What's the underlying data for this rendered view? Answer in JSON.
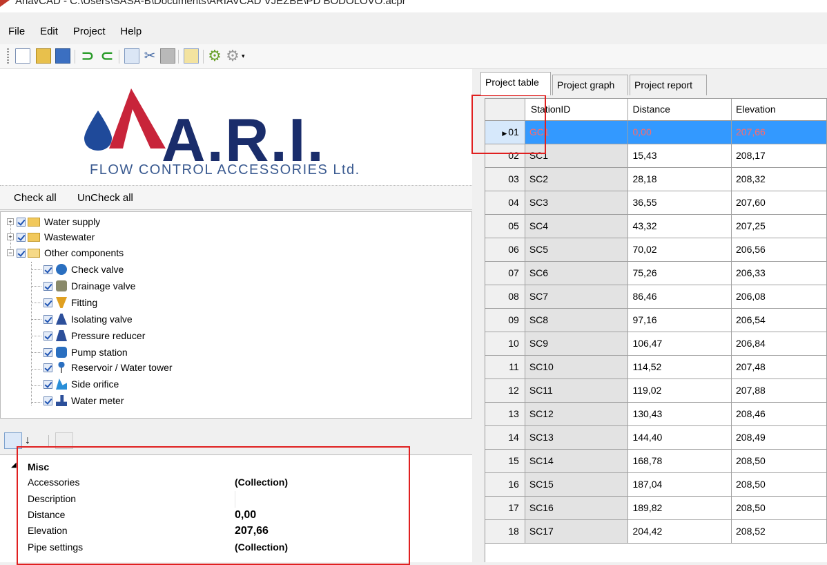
{
  "window": {
    "title": "AriavCAD - C:\\Users\\SASA-B\\Documents\\ARIAVCAD VJEZBE\\PD BODOLOVO.acpr"
  },
  "menu": [
    "File",
    "Edit",
    "Project",
    "Help"
  ],
  "toolbar": [
    "new-icon",
    "open-icon",
    "save-icon",
    "undo-icon",
    "redo-icon",
    "copy-icon",
    "cut-icon",
    "paste-icon",
    "properties-icon",
    "settings-icon",
    "settings-dropdown-icon"
  ],
  "logo": {
    "text": "A.R.I.",
    "subtitle": "FLOW CONTROL ACCESSORIES Ltd."
  },
  "checkbar": {
    "check_all": "Check all",
    "uncheck_all": "UnCheck all"
  },
  "tree": [
    {
      "label": "Water supply",
      "level": 0,
      "expander": "+"
    },
    {
      "label": "Wastewater",
      "level": 0,
      "expander": "+"
    },
    {
      "label": "Other components",
      "level": 0,
      "expander": "−"
    },
    {
      "label": "Check valve",
      "level": 1,
      "icon": "check-valve-icon"
    },
    {
      "label": "Drainage valve",
      "level": 1,
      "icon": "drainage-valve-icon"
    },
    {
      "label": "Fitting",
      "level": 1,
      "icon": "fitting-icon"
    },
    {
      "label": "Isolating valve",
      "level": 1,
      "icon": "isolating-valve-icon"
    },
    {
      "label": "Pressure reducer",
      "level": 1,
      "icon": "pressure-reducer-icon"
    },
    {
      "label": "Pump station",
      "level": 1,
      "icon": "pump-station-icon"
    },
    {
      "label": "Reservoir / Water tower",
      "level": 1,
      "icon": "reservoir-icon"
    },
    {
      "label": "Side orifice",
      "level": 1,
      "icon": "side-orifice-icon"
    },
    {
      "label": "Water meter",
      "level": 1,
      "icon": "water-meter-icon"
    }
  ],
  "property_grid": {
    "category": "Misc",
    "rows": [
      {
        "key": "Accessories",
        "value": "(Collection)"
      },
      {
        "key": "Description",
        "value": ""
      },
      {
        "key": "Distance",
        "value": "0,00"
      },
      {
        "key": "Elevation",
        "value": "207,66"
      },
      {
        "key": "Pipe settings",
        "value": "(Collection)"
      }
    ]
  },
  "tabs": [
    "Project table",
    "Project graph",
    "Project report"
  ],
  "table": {
    "columns": [
      "StationID",
      "Distance",
      "Elevation"
    ],
    "selected_row": 0,
    "rows": [
      [
        "01",
        "GC1",
        "0,00",
        "207,66"
      ],
      [
        "02",
        "SC1",
        "15,43",
        "208,17"
      ],
      [
        "03",
        "SC2",
        "28,18",
        "208,32"
      ],
      [
        "04",
        "SC3",
        "36,55",
        "207,60"
      ],
      [
        "05",
        "SC4",
        "43,32",
        "207,25"
      ],
      [
        "06",
        "SC5",
        "70,02",
        "206,56"
      ],
      [
        "07",
        "SC6",
        "75,26",
        "206,33"
      ],
      [
        "08",
        "SC7",
        "86,46",
        "206,08"
      ],
      [
        "09",
        "SC8",
        "97,16",
        "206,54"
      ],
      [
        "10",
        "SC9",
        "106,47",
        "206,84"
      ],
      [
        "11",
        "SC10",
        "114,52",
        "207,48"
      ],
      [
        "12",
        "SC11",
        "119,02",
        "207,88"
      ],
      [
        "13",
        "SC12",
        "130,43",
        "208,46"
      ],
      [
        "14",
        "SC13",
        "144,40",
        "208,49"
      ],
      [
        "15",
        "SC14",
        "168,78",
        "208,50"
      ],
      [
        "16",
        "SC15",
        "187,04",
        "208,50"
      ],
      [
        "17",
        "SC16",
        "189,82",
        "208,50"
      ],
      [
        "18",
        "SC17",
        "204,42",
        "208,52"
      ]
    ]
  },
  "colors": {
    "selection": "#3399ff",
    "selected_text": "#ff6a6a",
    "highlight_box": "#e02020",
    "logo_blue": "#1a2d6b"
  }
}
